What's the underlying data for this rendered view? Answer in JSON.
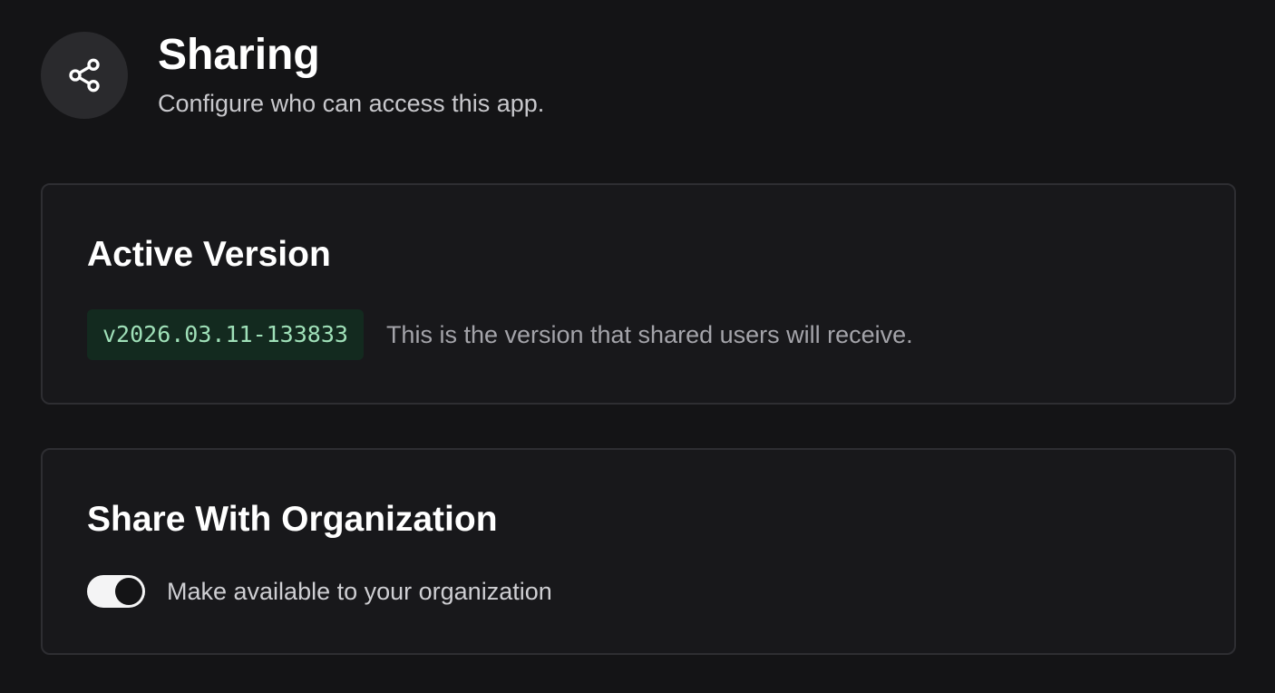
{
  "header": {
    "icon": "share-icon",
    "title": "Sharing",
    "subtitle": "Configure who can access this app."
  },
  "active_version": {
    "title": "Active Version",
    "version": "v2026.03.11-133833",
    "description": "This is the version that shared users will receive.",
    "badge_bg": "#132a1f",
    "badge_text": "#9fe0b8"
  },
  "share_org": {
    "title": "Share With Organization",
    "toggle_label": "Make available to your organization",
    "toggle_on": true
  }
}
